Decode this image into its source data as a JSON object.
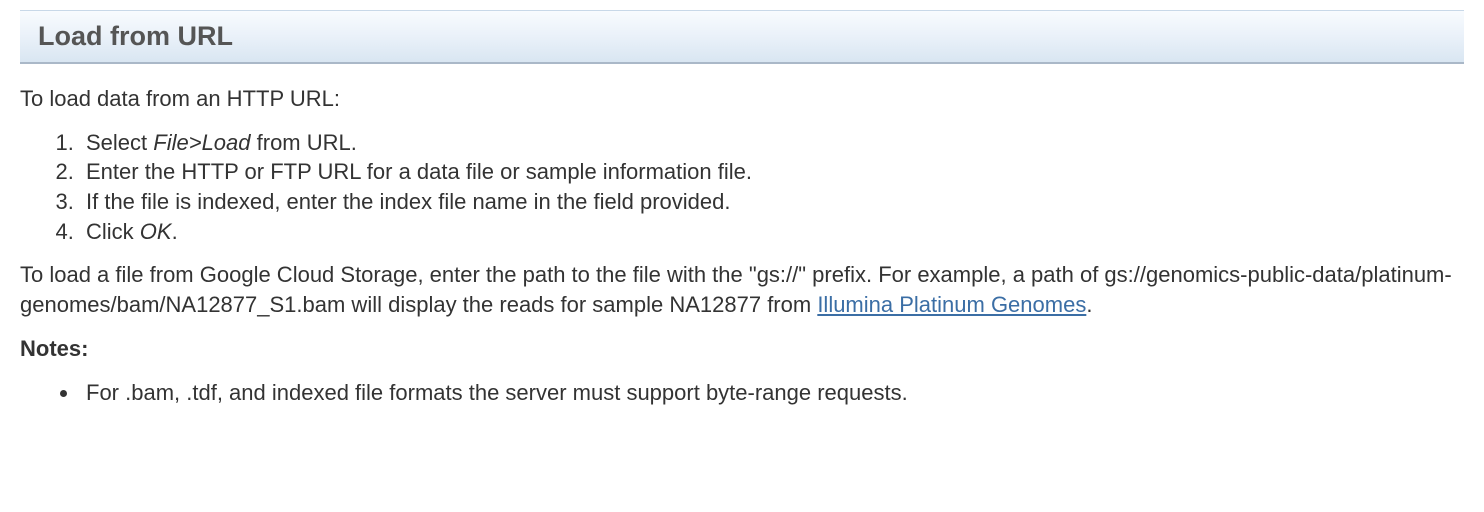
{
  "header": {
    "title": "Load from URL"
  },
  "intro_text": "To load data from an HTTP URL:",
  "steps": [
    {
      "prefix": "Select ",
      "italic": "File>Load",
      "suffix": " from URL."
    },
    {
      "prefix": "Enter the HTTP or FTP URL for a data file or sample information file.",
      "italic": "",
      "suffix": ""
    },
    {
      "prefix": "If the file is indexed, enter the index file name in the field provided.",
      "italic": "",
      "suffix": ""
    },
    {
      "prefix": "Click ",
      "italic": "OK",
      "suffix": "."
    }
  ],
  "gcs_paragraph": {
    "prefix": "To load a file from Google Cloud Storage, enter the path to the file with the \"gs://\" prefix. For example, a path of gs://genomics-public-data/platinum-genomes/bam/NA12877_S1.bam will display the reads for sample NA12877 from ",
    "link_text": "Illumina Platinum Genomes",
    "suffix": "."
  },
  "notes_label": "Notes:",
  "notes": [
    "For .bam, .tdf, and indexed file formats the server must support byte-range requests."
  ]
}
